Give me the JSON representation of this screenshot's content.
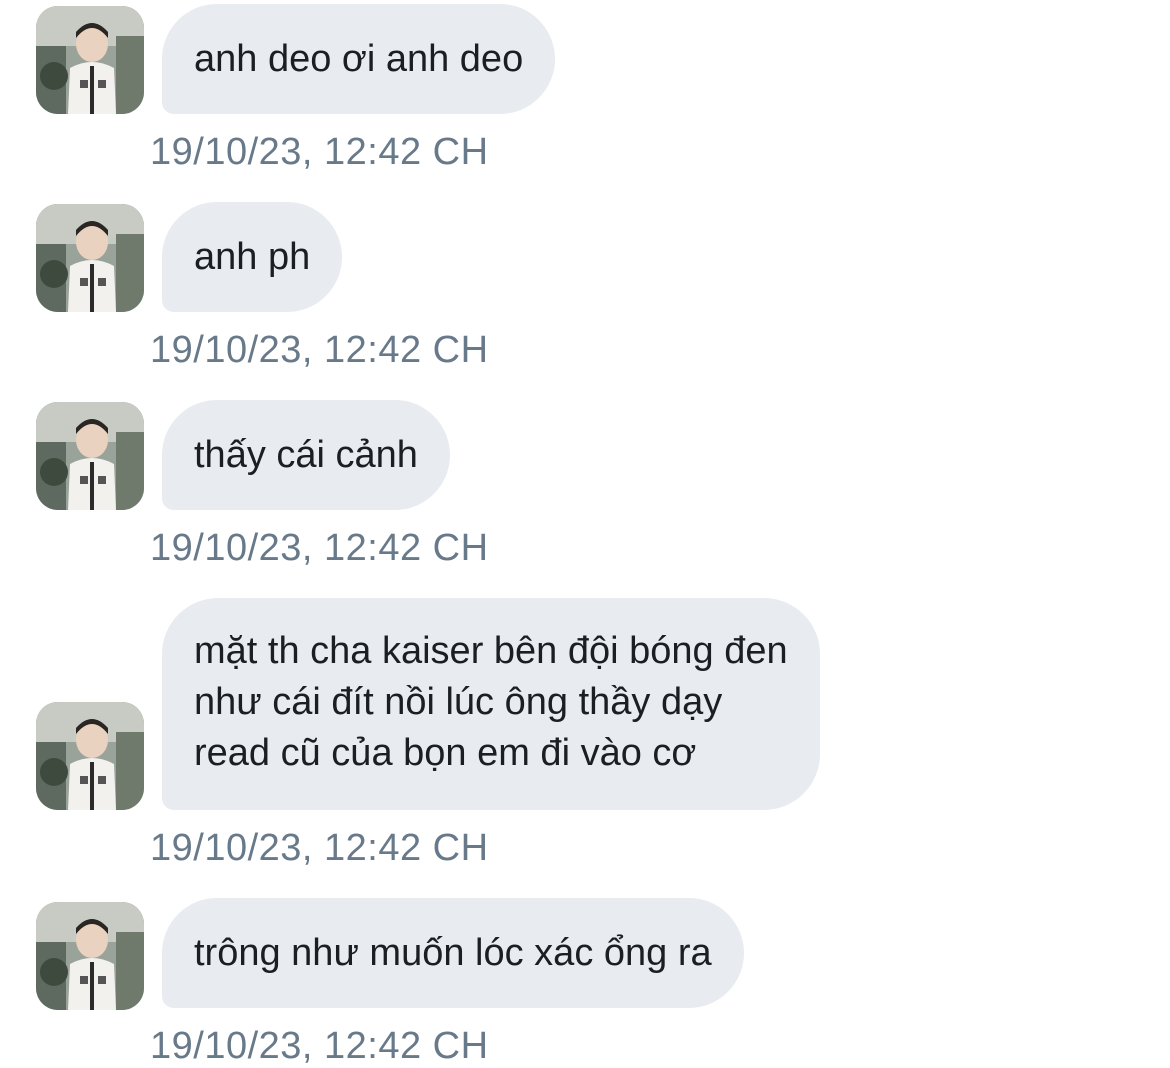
{
  "conversation": {
    "messages": [
      {
        "lines": [
          "anh deo ơi anh deo"
        ],
        "timestamp": "19/10/23, 12:42 CH"
      },
      {
        "lines": [
          "anh ph"
        ],
        "timestamp": "19/10/23, 12:42 CH"
      },
      {
        "lines": [
          "thấy cái cảnh"
        ],
        "timestamp": "19/10/23, 12:42 CH"
      },
      {
        "lines": [
          "mặt th cha kaiser bên đội bóng đen",
          "như cái đít nồi lúc ông thầy dạy",
          "read cũ của bọn em đi vào cơ"
        ],
        "timestamp": "19/10/23, 12:42 CH"
      },
      {
        "lines": [
          "trông như muốn lóc xác ổng ra"
        ],
        "timestamp": "19/10/23, 12:42 CH"
      }
    ]
  },
  "colors": {
    "bubble_background": "#e8ebef",
    "message_text": "#1b1f23",
    "timestamp_text": "#68798a",
    "page_background": "#ffffff"
  },
  "icons": {
    "avatar": "user-avatar-photo"
  }
}
